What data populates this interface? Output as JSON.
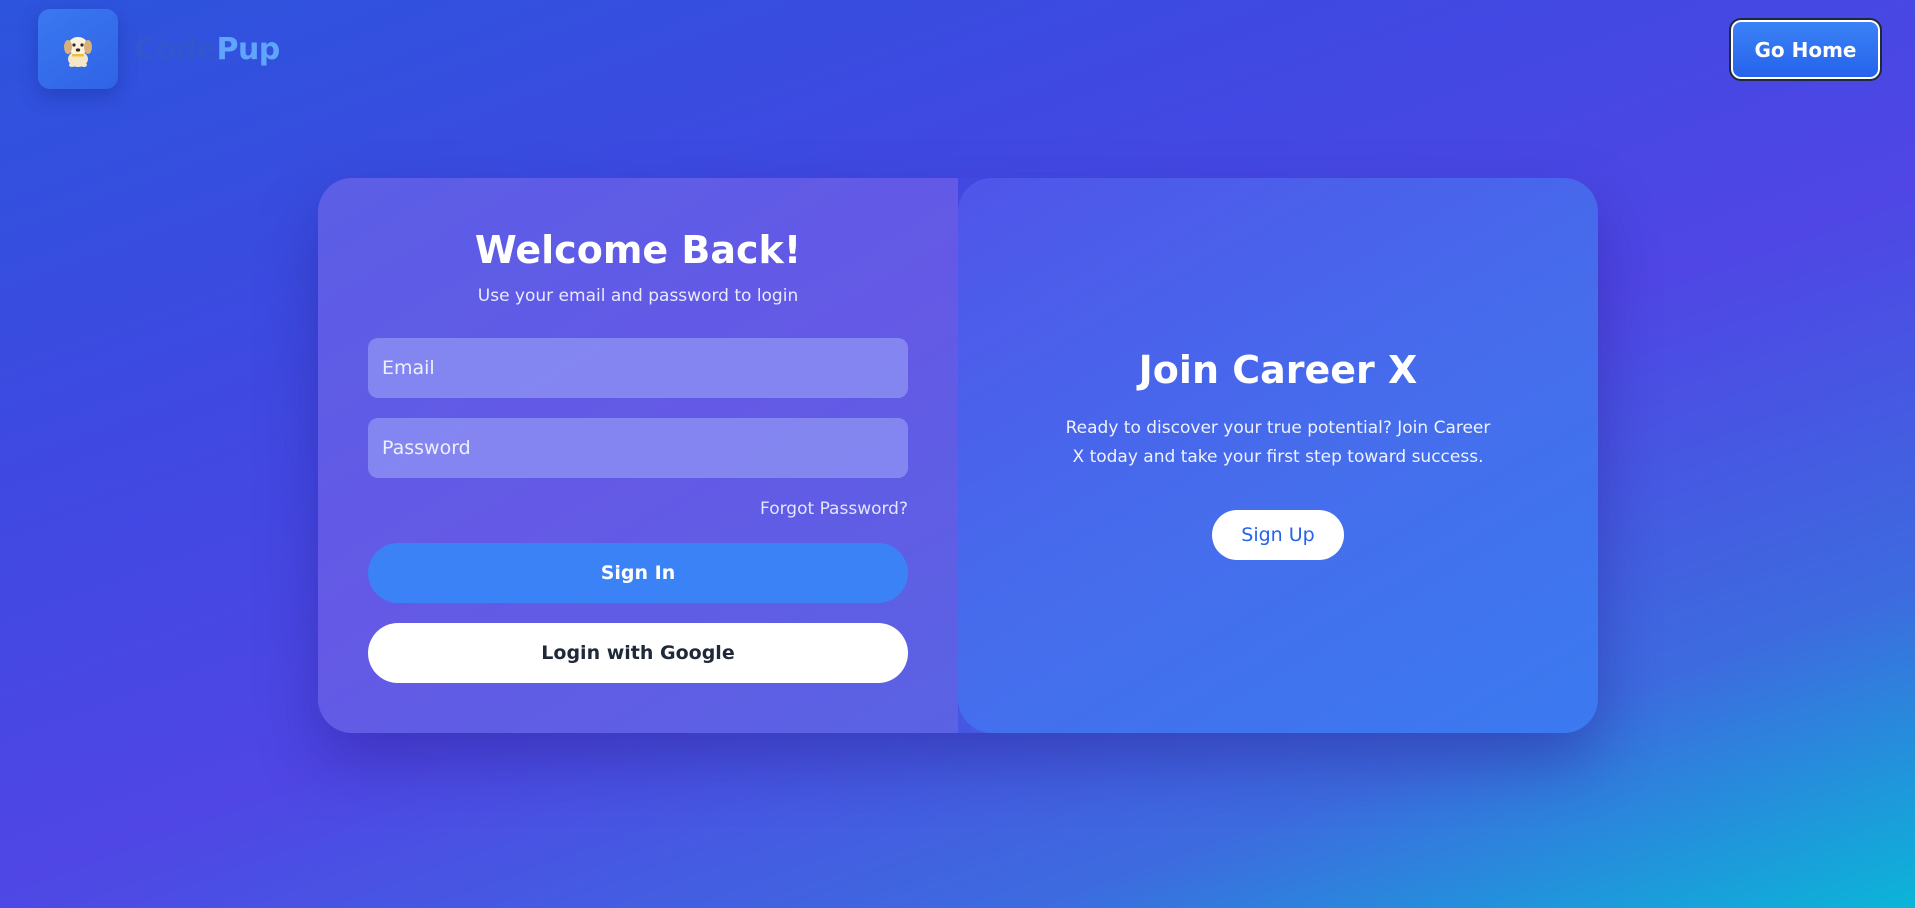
{
  "brand": {
    "name_part1": "Code",
    "name_part2": "Pup",
    "logo_icon": "puppy-icon"
  },
  "header": {
    "go_home_label": "Go Home"
  },
  "login": {
    "title": "Welcome Back!",
    "subtitle": "Use your email and password to login",
    "email_placeholder": "Email",
    "password_placeholder": "Password",
    "forgot_label": "Forgot Password?",
    "signin_label": "Sign In",
    "google_label": "Login with Google"
  },
  "join": {
    "title": "Join Career X",
    "description": "Ready to discover your true potential? Join Career X today and take your first step toward success.",
    "signup_label": "Sign Up"
  },
  "colors": {
    "primary": "#3b82f6",
    "brand_dark": "#3057cf",
    "brand_light": "#60a5fa"
  }
}
